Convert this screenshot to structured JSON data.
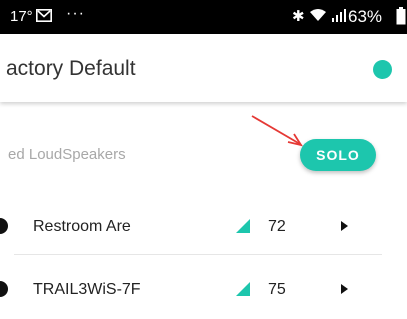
{
  "status_bar": {
    "time": "17°",
    "more": "···",
    "battery": "63%",
    "icons": [
      "mail-icon",
      "bluetooth-icon",
      "wifi-icon",
      "signal-icon",
      "battery-icon"
    ]
  },
  "header": {
    "title": "actory Default",
    "status_dot_color": "#1dc6ad"
  },
  "section": {
    "label": "ed LoudSpeakers",
    "solo_label": "SOLO"
  },
  "speakers": [
    {
      "name": "Restroom Are",
      "volume": "72"
    },
    {
      "name": "TRAIL3WiS-7F",
      "volume": "75"
    }
  ],
  "colors": {
    "accent": "#1dc6ad",
    "annotation_arrow": "#e53935"
  }
}
